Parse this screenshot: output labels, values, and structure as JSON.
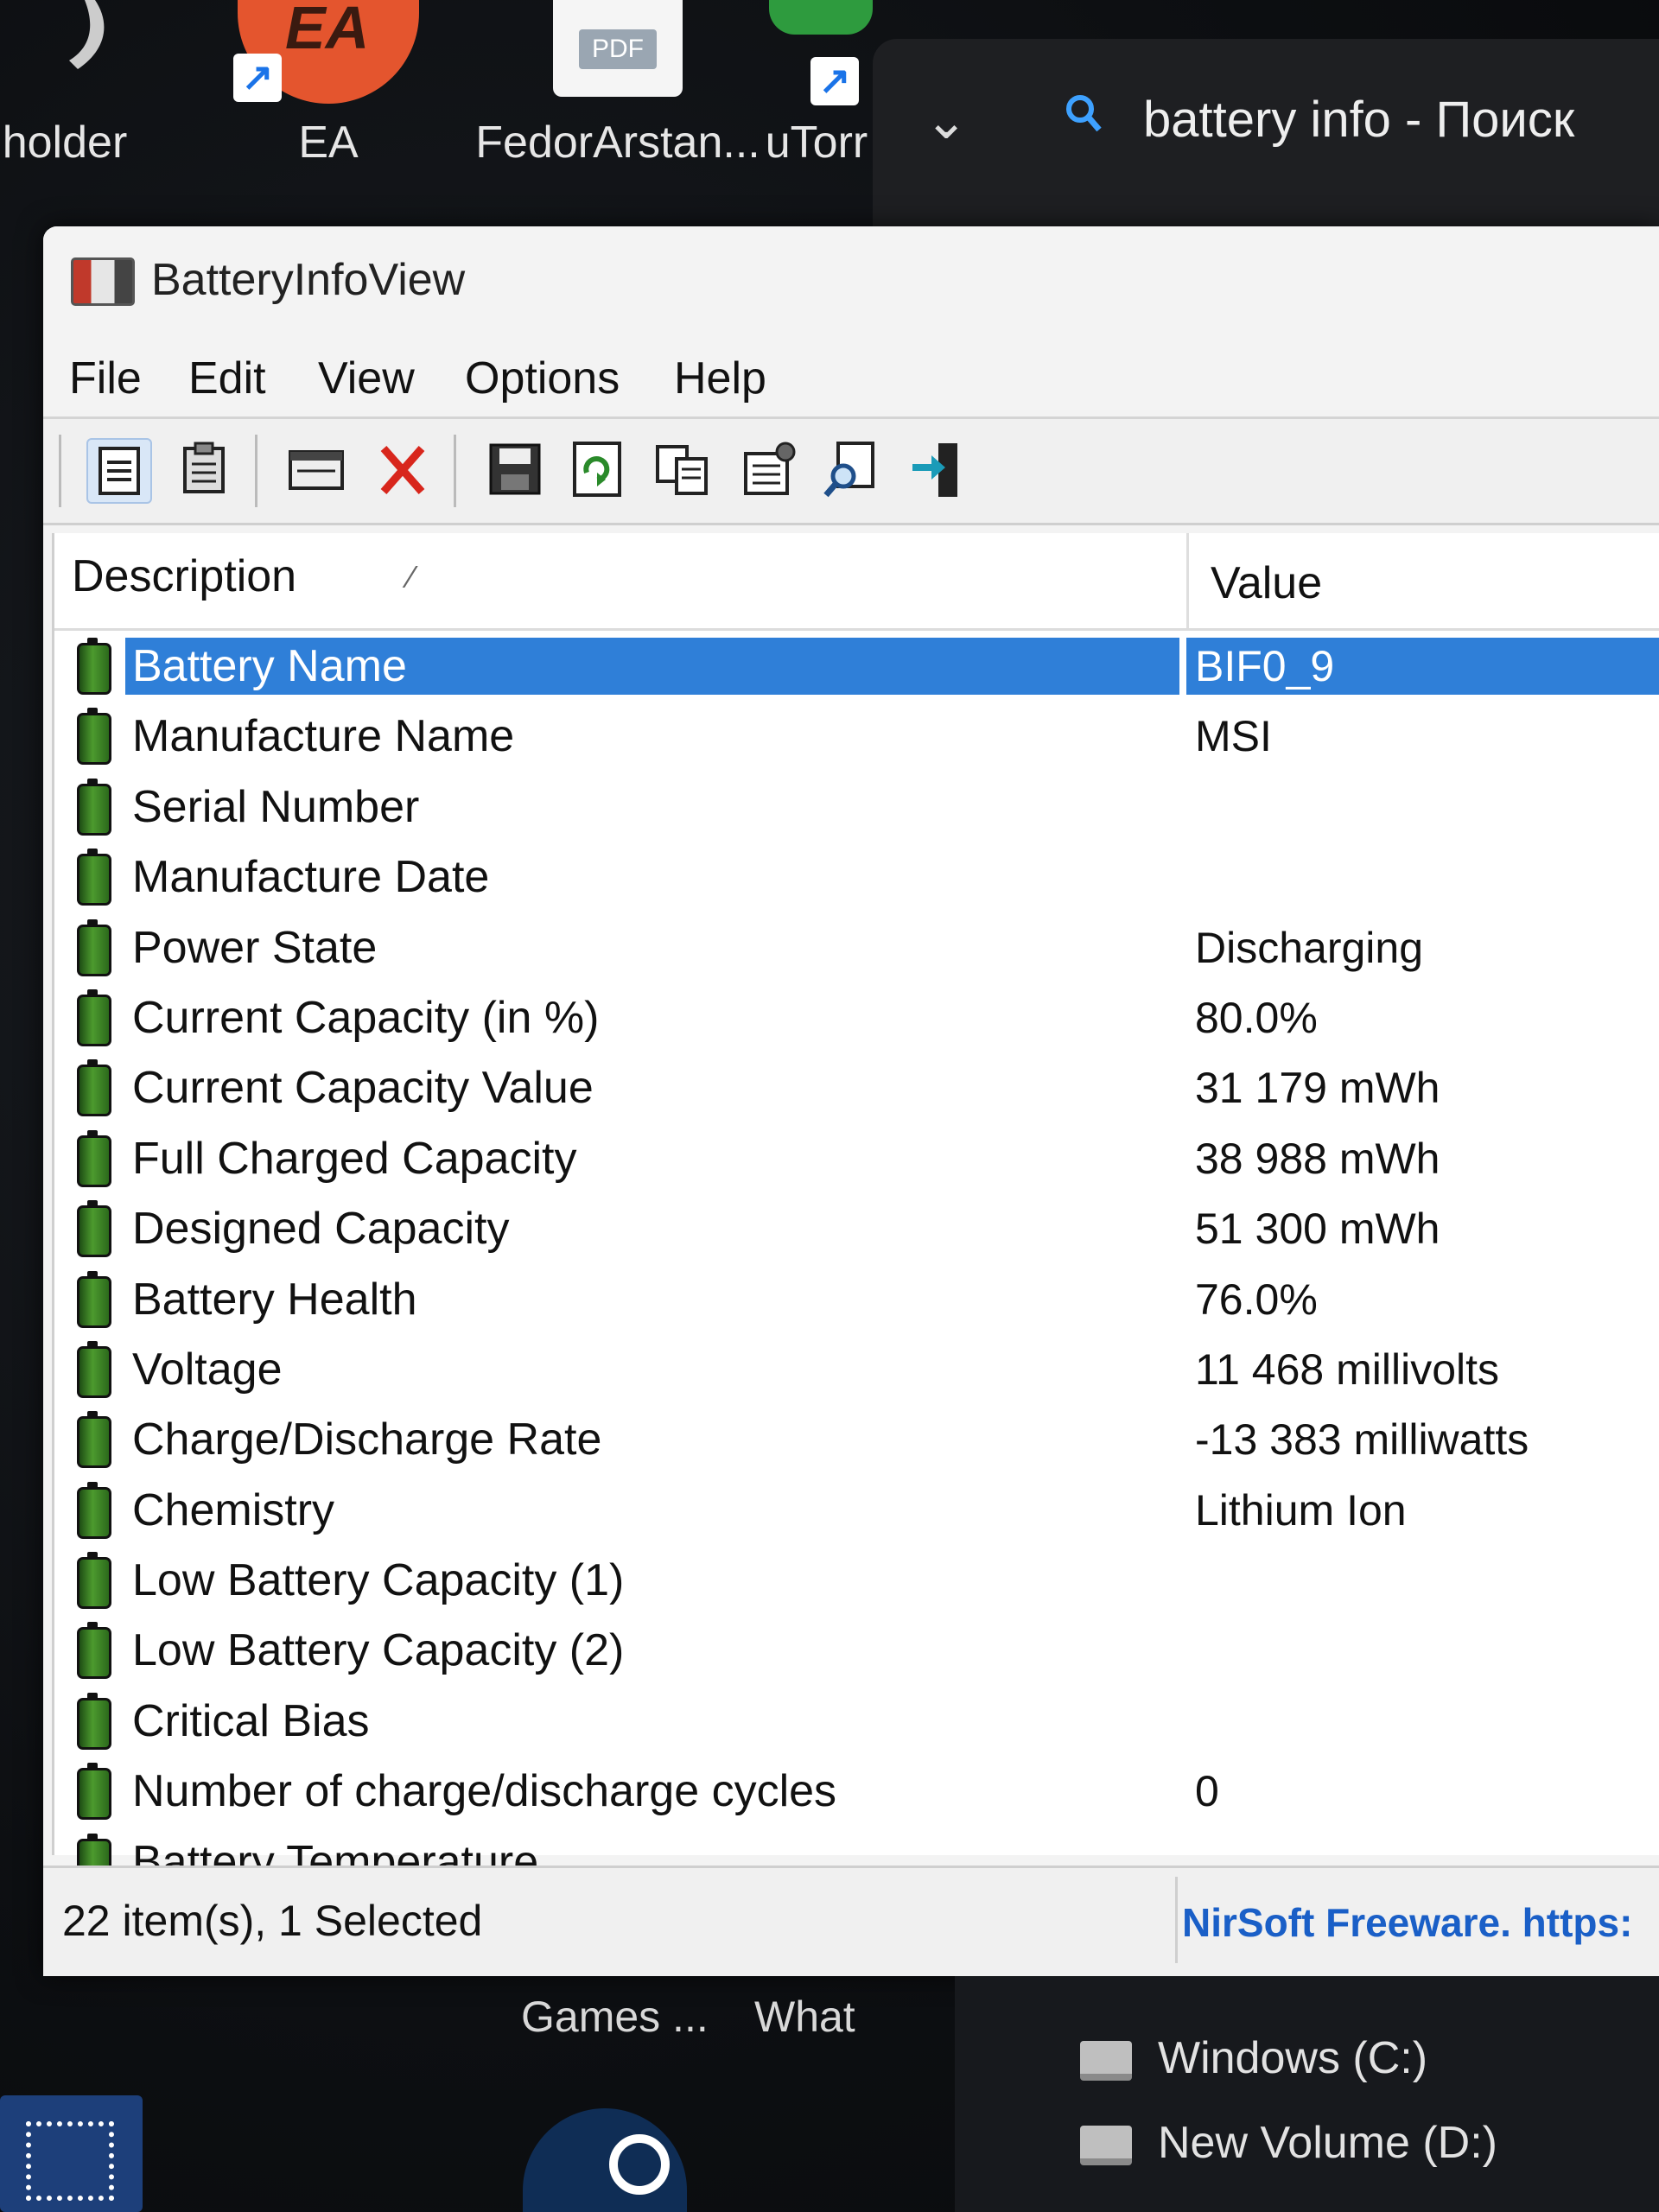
{
  "desktop": {
    "icons": [
      {
        "label": "holder"
      },
      {
        "label": "EA",
        "logo_text": "EA"
      },
      {
        "label": "FedorArstan...",
        "logo_text": "PDF"
      },
      {
        "label": "uTorr"
      }
    ],
    "bottom_labels": [
      "Games ...",
      "What"
    ],
    "drives": [
      "Windows (C:)",
      "New Volume (D:)"
    ]
  },
  "search_panel": {
    "text": "battery info - Поиск",
    "accent_color": "#3ea1ff"
  },
  "window": {
    "title": "BatteryInfoView",
    "menu": [
      "File",
      "Edit",
      "View",
      "Options",
      "Help"
    ],
    "toolbar_icons": [
      "html-report-all-icon",
      "clipboard-icon",
      "window-icon",
      "delete-icon",
      "save-icon",
      "refresh-icon",
      "copy-icon",
      "properties-icon",
      "find-icon",
      "exit-icon"
    ],
    "columns": {
      "description": "Description",
      "value": "Value"
    },
    "rows": [
      {
        "description": "Battery Name",
        "value": "BIF0_9",
        "selected": true
      },
      {
        "description": "Manufacture Name",
        "value": "MSI"
      },
      {
        "description": "Serial Number",
        "value": ""
      },
      {
        "description": "Manufacture Date",
        "value": ""
      },
      {
        "description": "Power State",
        "value": "Discharging"
      },
      {
        "description": "Current Capacity (in %)",
        "value": "80.0%"
      },
      {
        "description": "Current Capacity Value",
        "value": "31 179 mWh"
      },
      {
        "description": "Full Charged Capacity",
        "value": "38 988 mWh"
      },
      {
        "description": "Designed Capacity",
        "value": "51 300 mWh"
      },
      {
        "description": "Battery Health",
        "value": "76.0%"
      },
      {
        "description": "Voltage",
        "value": "11 468 millivolts"
      },
      {
        "description": "Charge/Discharge Rate",
        "value": "-13 383 milliwatts"
      },
      {
        "description": "Chemistry",
        "value": "Lithium Ion"
      },
      {
        "description": "Low Battery Capacity (1)",
        "value": ""
      },
      {
        "description": "Low Battery Capacity (2)",
        "value": ""
      },
      {
        "description": "Critical Bias",
        "value": ""
      },
      {
        "description": "Number of charge/discharge cycles",
        "value": "0"
      },
      {
        "description": "Battery Temperature",
        "value": ""
      }
    ],
    "status": {
      "items": "22 item(s), 1 Selected",
      "link": "NirSoft Freeware. https:"
    },
    "selection_color": "#2f7fd8",
    "link_color": "#1a5fc7"
  }
}
